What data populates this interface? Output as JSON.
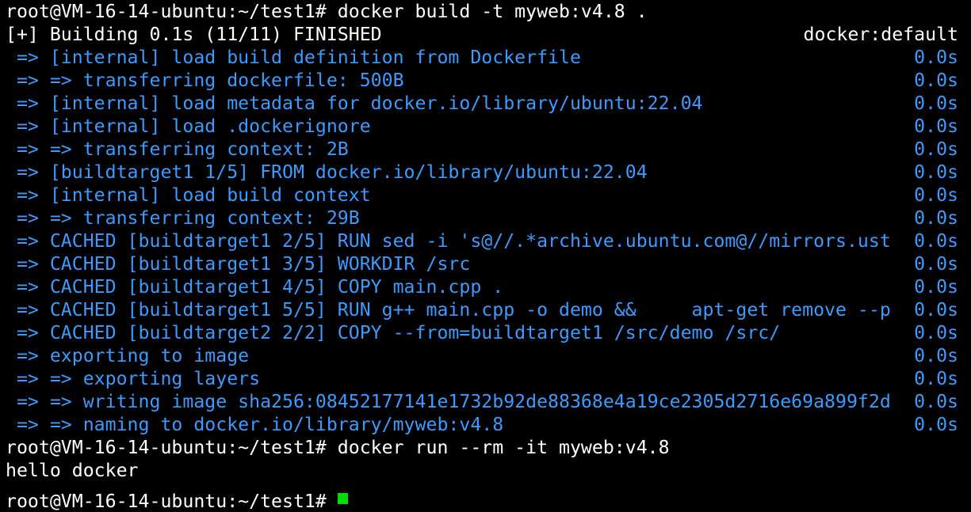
{
  "terminal": {
    "lines": [
      {
        "text": "root@VM-16-14-ubuntu:~/test1# docker build -t myweb:v4.8 .",
        "time": "",
        "style": "white"
      },
      {
        "text": "[+] Building 0.1s (11/11) FINISHED",
        "time": "docker:default",
        "style": "white"
      },
      {
        "text": " => [internal] load build definition from Dockerfile",
        "time": "0.0s",
        "style": "blue"
      },
      {
        "text": " => => transferring dockerfile: 500B",
        "time": "0.0s",
        "style": "blue"
      },
      {
        "text": " => [internal] load metadata for docker.io/library/ubuntu:22.04",
        "time": "0.0s",
        "style": "blue"
      },
      {
        "text": " => [internal] load .dockerignore",
        "time": "0.0s",
        "style": "blue"
      },
      {
        "text": " => => transferring context: 2B",
        "time": "0.0s",
        "style": "blue"
      },
      {
        "text": " => [buildtarget1 1/5] FROM docker.io/library/ubuntu:22.04",
        "time": "0.0s",
        "style": "blue"
      },
      {
        "text": " => [internal] load build context",
        "time": "0.0s",
        "style": "blue"
      },
      {
        "text": " => => transferring context: 29B",
        "time": "0.0s",
        "style": "blue"
      },
      {
        "text": " => CACHED [buildtarget1 2/5] RUN sed -i 's@//.*archive.ubuntu.com@//mirrors.ust",
        "time": "0.0s",
        "style": "blue"
      },
      {
        "text": " => CACHED [buildtarget1 3/5] WORKDIR /src",
        "time": "0.0s",
        "style": "blue"
      },
      {
        "text": " => CACHED [buildtarget1 4/5] COPY main.cpp .",
        "time": "0.0s",
        "style": "blue"
      },
      {
        "text": " => CACHED [buildtarget1 5/5] RUN g++ main.cpp -o demo &&     apt-get remove --p",
        "time": "0.0s",
        "style": "blue"
      },
      {
        "text": " => CACHED [buildtarget2 2/2] COPY --from=buildtarget1 /src/demo /src/",
        "time": "0.0s",
        "style": "blue"
      },
      {
        "text": " => exporting to image",
        "time": "0.0s",
        "style": "blue"
      },
      {
        "text": " => => exporting layers",
        "time": "0.0s",
        "style": "blue"
      },
      {
        "text": " => => writing image sha256:08452177141e1732b92de88368e4a19ce2305d2716e69a899f2d",
        "time": "0.0s",
        "style": "blue"
      },
      {
        "text": " => => naming to docker.io/library/myweb:v4.8",
        "time": "0.0s",
        "style": "blue"
      },
      {
        "text": "root@VM-16-14-ubuntu:~/test1# docker run --rm -it myweb:v4.8",
        "time": "",
        "style": "white"
      },
      {
        "text": "hello docker",
        "time": "",
        "style": "white"
      }
    ],
    "prompt_partial": "root@VM-16-14-ubuntu:~/test1# "
  },
  "colors": {
    "background": "#000000",
    "foreground": "#ffffff",
    "build_output": "#3d9bff",
    "cursor": "#00e000"
  }
}
